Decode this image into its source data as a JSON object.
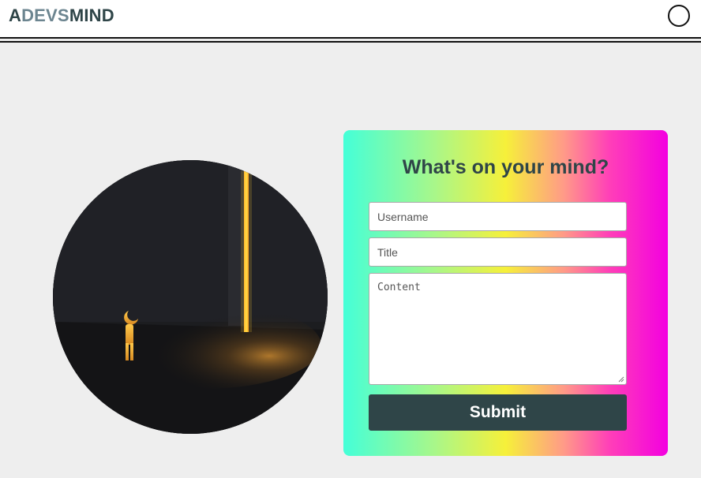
{
  "header": {
    "logo_a": "A",
    "logo_devs": "DEVS",
    "logo_mind": "MIND"
  },
  "form": {
    "heading": "What's on your mind?",
    "username_placeholder": "Username",
    "title_placeholder": "Title",
    "content_placeholder": "Content",
    "submit_label": "Submit"
  },
  "colors": {
    "brand_dark": "#2f4548",
    "brand_light": "#6c8590",
    "page_bg": "#eeeeee",
    "gradient": [
      "#44ffd8",
      "#a8f78a",
      "#f6f03a",
      "#ff9a88",
      "#ff3fb8",
      "#f300e0"
    ]
  }
}
